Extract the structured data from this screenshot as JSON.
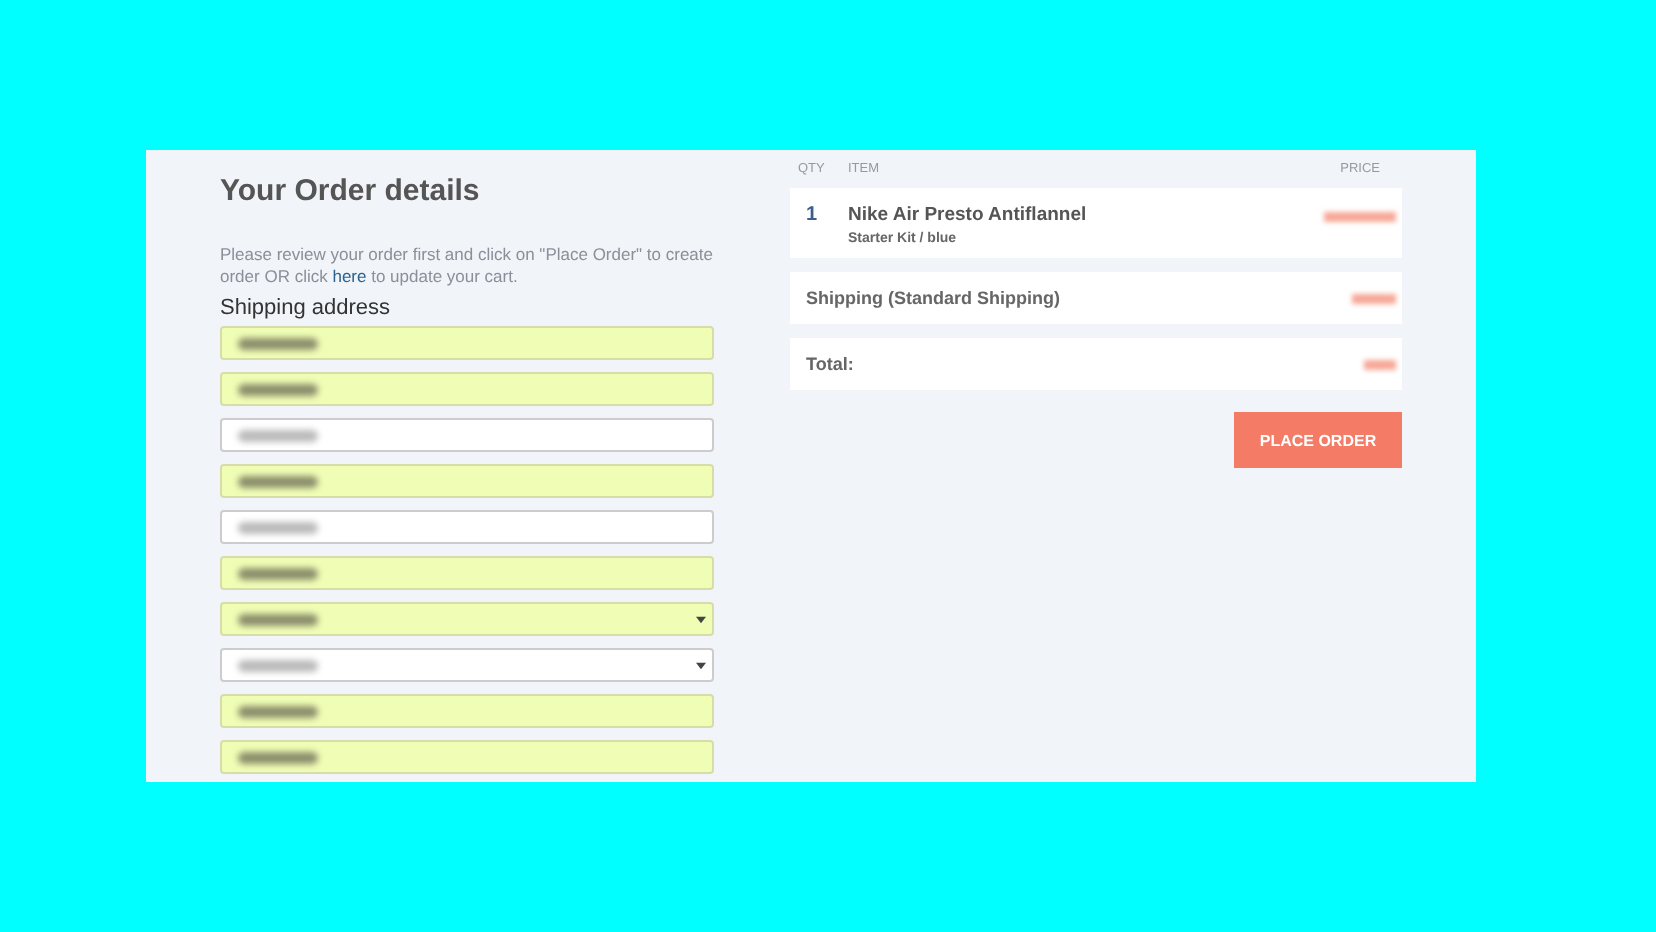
{
  "heading": "Your Order details",
  "intro": {
    "before": "Please review your order first and click on \"Place Order\" to create order OR click",
    "link": "here",
    "after": "to update your cart."
  },
  "shipping_title": "Shipping address",
  "fields": [
    {
      "kind": "text",
      "autofilled": true
    },
    {
      "kind": "text",
      "autofilled": true
    },
    {
      "kind": "text",
      "autofilled": false
    },
    {
      "kind": "text",
      "autofilled": true
    },
    {
      "kind": "text",
      "autofilled": false
    },
    {
      "kind": "text",
      "autofilled": true
    },
    {
      "kind": "select",
      "autofilled": true
    },
    {
      "kind": "select",
      "autofilled": false
    },
    {
      "kind": "text",
      "autofilled": true
    },
    {
      "kind": "text",
      "autofilled": true
    }
  ],
  "columns": [
    "QTY",
    "ITEM",
    "PRICE"
  ],
  "items": [
    {
      "qty": "1",
      "name": "Nike Air Presto Antiflannel",
      "variant": "Starter Kit / blue"
    }
  ],
  "shipping_row": "Shipping (Standard Shipping)",
  "total_label": "Total:",
  "place_order": "PLACE ORDER"
}
